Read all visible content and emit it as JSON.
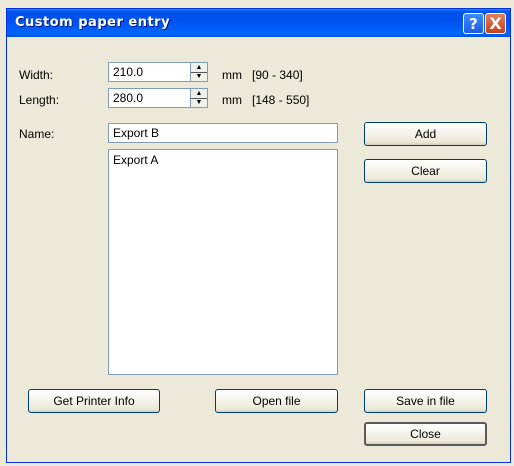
{
  "window": {
    "title": "Custom paper entry",
    "help_icon": "?",
    "close_icon": "X"
  },
  "width": {
    "label": "Width:",
    "value": "210.0",
    "unit": "mm",
    "range": "[90 - 340]"
  },
  "length": {
    "label": "Length:",
    "value": "280.0",
    "unit": "mm",
    "range": "[148 - 550]"
  },
  "name": {
    "label": "Name:",
    "value": "Export B"
  },
  "list": {
    "items": [
      "Export A"
    ]
  },
  "buttons": {
    "add": "Add",
    "clear": "Clear",
    "get_printer_info": "Get Printer Info",
    "open_file": "Open file",
    "save_in_file": "Save in file",
    "close": "Close"
  }
}
